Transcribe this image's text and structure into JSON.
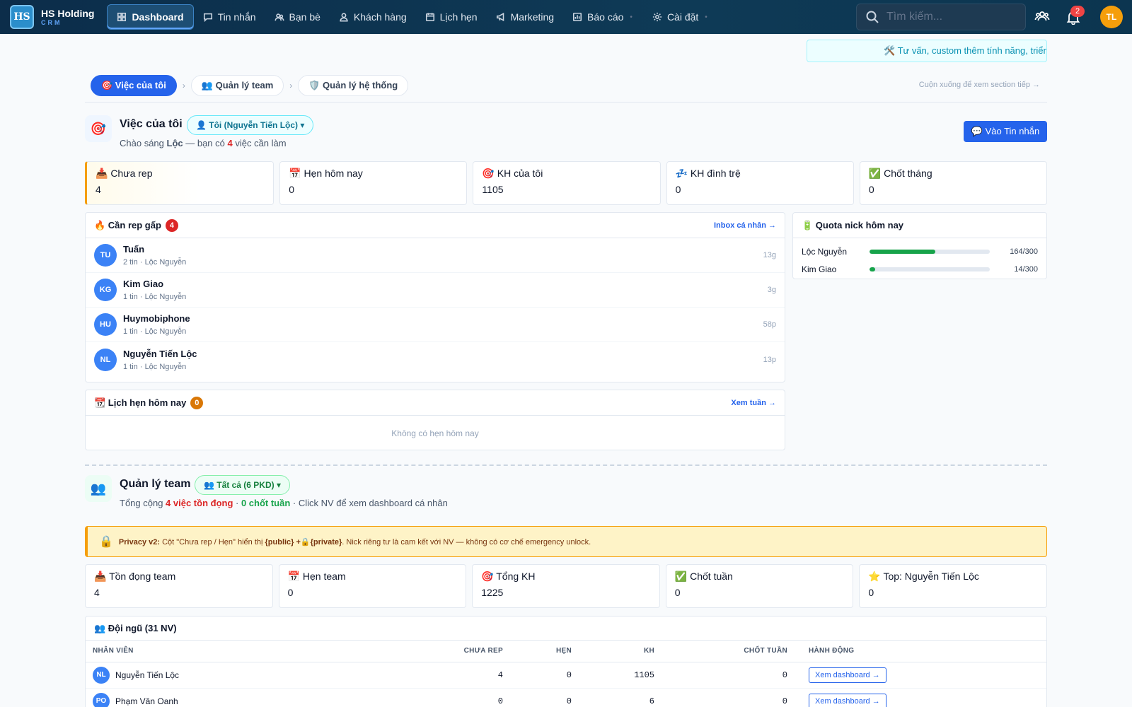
{
  "nav": {
    "brand_logo": "HS",
    "brand_name": "HS Holding",
    "brand_sub": "CRM",
    "items": [
      {
        "label": "Dashboard",
        "icon": "dashboard-icon"
      },
      {
        "label": "Tin nhắn",
        "icon": "chat-icon"
      },
      {
        "label": "Bạn bè",
        "icon": "friends-icon"
      },
      {
        "label": "Khách hàng",
        "icon": "customer-icon"
      },
      {
        "label": "Lịch hẹn",
        "icon": "calendar-icon"
      },
      {
        "label": "Marketing",
        "icon": "megaphone-icon"
      },
      {
        "label": "Báo cáo",
        "icon": "report-icon"
      },
      {
        "label": "Cài đặt",
        "icon": "gear-icon"
      }
    ],
    "search_placeholder": "Tìm kiếm...",
    "notif_count": "2",
    "avatar": "TL"
  },
  "banner": "🛠️ Tư vấn, custom thêm tính năng, triển",
  "crumbs": {
    "mine": "🎯 Việc của tôi",
    "team": "👥 Quản lý team",
    "system": "🛡️ Quản lý hệ thống",
    "hint": "Cuộn xuống để xem section tiếp →"
  },
  "mine": {
    "title": "Việc của tôi",
    "scope_chip": "👤 Tôi (Nguyễn Tiến Lộc) ▾",
    "greeting_pre": "Chào sáng ",
    "greeting_name": "Lộc",
    "greeting_mid": " — bạn có ",
    "greeting_count": "4",
    "greeting_post": " việc cần làm",
    "button": "💬 Vào Tin nhắn",
    "cards": [
      {
        "label": "📥 Chưa rep",
        "value": "4"
      },
      {
        "label": "📅 Hẹn hôm nay",
        "value": "0"
      },
      {
        "label": "🎯 KH của tôi",
        "value": "1105"
      },
      {
        "label": "💤 KH đình trệ",
        "value": "0"
      },
      {
        "label": "✅ Chốt tháng",
        "value": "0"
      }
    ]
  },
  "urgent": {
    "title": "🔥 Cần rep gấp",
    "count": "4",
    "link": "Inbox cá nhân →",
    "rows": [
      {
        "initials": "TU",
        "name": "Tuấn",
        "meta": "2 tin · Lộc Nguyễn",
        "time": "13g"
      },
      {
        "initials": "KG",
        "name": "Kim Giao",
        "meta": "1 tin · Lộc Nguyễn",
        "time": "3g"
      },
      {
        "initials": "HU",
        "name": "Huymobiphone",
        "meta": "1 tin · Lộc Nguyễn",
        "time": "58p"
      },
      {
        "initials": "NL",
        "name": "Nguyễn Tiến Lộc",
        "meta": "1 tin · Lộc Nguyễn",
        "time": "13p"
      }
    ]
  },
  "quota": {
    "title": "🔋 Quota nick hôm nay",
    "rows": [
      {
        "name": "Lộc Nguyễn",
        "value": "164/300",
        "fraction": 0.547
      },
      {
        "name": "Kim Giao",
        "value": "14/300",
        "fraction": 0.047
      }
    ]
  },
  "today": {
    "title": "📆 Lịch hẹn hôm nay",
    "count": "0",
    "link": "Xem tuần →",
    "empty": "Không có hẹn hôm nay"
  },
  "team": {
    "title": "Quản lý team",
    "scope_chip": "👥 Tất cả (6 PKD) ▾",
    "sub_pre": "Tổng cộng ",
    "sub_pending": "4 việc tồn đọng",
    "sub_sep": " · ",
    "sub_closed": "0 chốt tuần",
    "sub_post": " · Click NV để xem dashboard cá nhân",
    "privacy_label": "Privacy v2:",
    "privacy_pre": " Cột \"Chưa rep / Hẹn\" hiển thị ",
    "privacy_code": "{public} +🔒{private}",
    "privacy_post": ". Nick riêng tư là cam kết với NV — không có cơ chế emergency unlock.",
    "cards": [
      {
        "label": "📥 Tồn đọng team",
        "value": "4"
      },
      {
        "label": "📅 Hẹn team",
        "value": "0"
      },
      {
        "label": "🎯 Tổng KH",
        "value": "1225"
      },
      {
        "label": "✅ Chốt tuần",
        "value": "0"
      },
      {
        "label": "⭐ Top: Nguyễn Tiến Lộc",
        "value": "0"
      }
    ],
    "table_title": "👥 Đội ngũ (31 NV)",
    "columns": [
      "NHÂN VIÊN",
      "CHƯA REP",
      "HẸN",
      "KH",
      "CHỐT TUẦN",
      "HÀNH ĐỘNG"
    ],
    "rows": [
      {
        "initials": "NL",
        "name": "Nguyễn Tiến Lộc",
        "chua_rep": "4",
        "hen": "0",
        "kh": "1105",
        "chot": "0",
        "action": "Xem dashboard →"
      },
      {
        "initials": "PO",
        "name": "Phạm Văn Oanh",
        "chua_rep": "0",
        "hen": "0",
        "kh": "6",
        "chot": "0",
        "action": "Xem dashboard →"
      }
    ]
  },
  "colors": {
    "primary": "#2563eb",
    "nav_bg": "#0c2d4a",
    "danger": "#ef4444",
    "warning": "#f59e0b",
    "success": "#16a34a"
  }
}
